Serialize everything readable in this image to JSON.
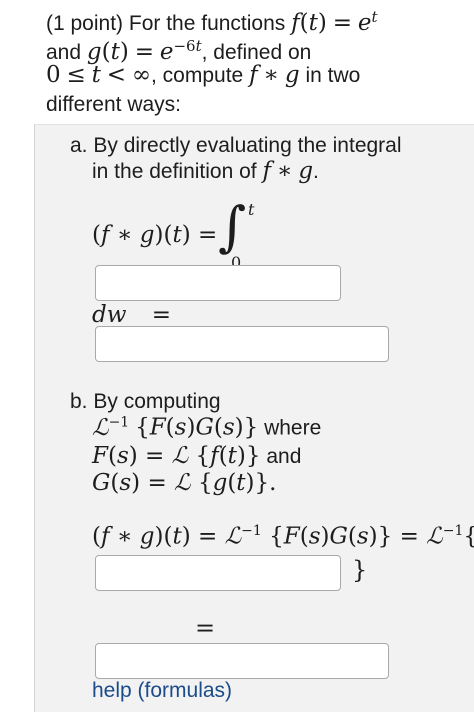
{
  "header": {
    "line1_text": "(1 point) For the functions",
    "line2_and": "and",
    "line2_defined": ", defined on",
    "line3_compute": ", compute",
    "line3_in_two": "in two",
    "line4_text": "different ways:"
  },
  "part_a": {
    "label": "a. By directly evaluating the integral",
    "line2": "in the definition of",
    "dw": "dw",
    "equals": "="
  },
  "part_b": {
    "label": "b. By computing",
    "where": "where",
    "and": "and",
    "equals": "="
  },
  "footer": {
    "help_link": "help (formulas)"
  },
  "inputs": {
    "integrand": "",
    "integral_result": "",
    "inverse_laplace_arg": "",
    "final_result": ""
  },
  "colors": {
    "panel_bg": "#f2f2f2",
    "link": "#1a4b8a",
    "input_border": "#a9a9a9"
  }
}
